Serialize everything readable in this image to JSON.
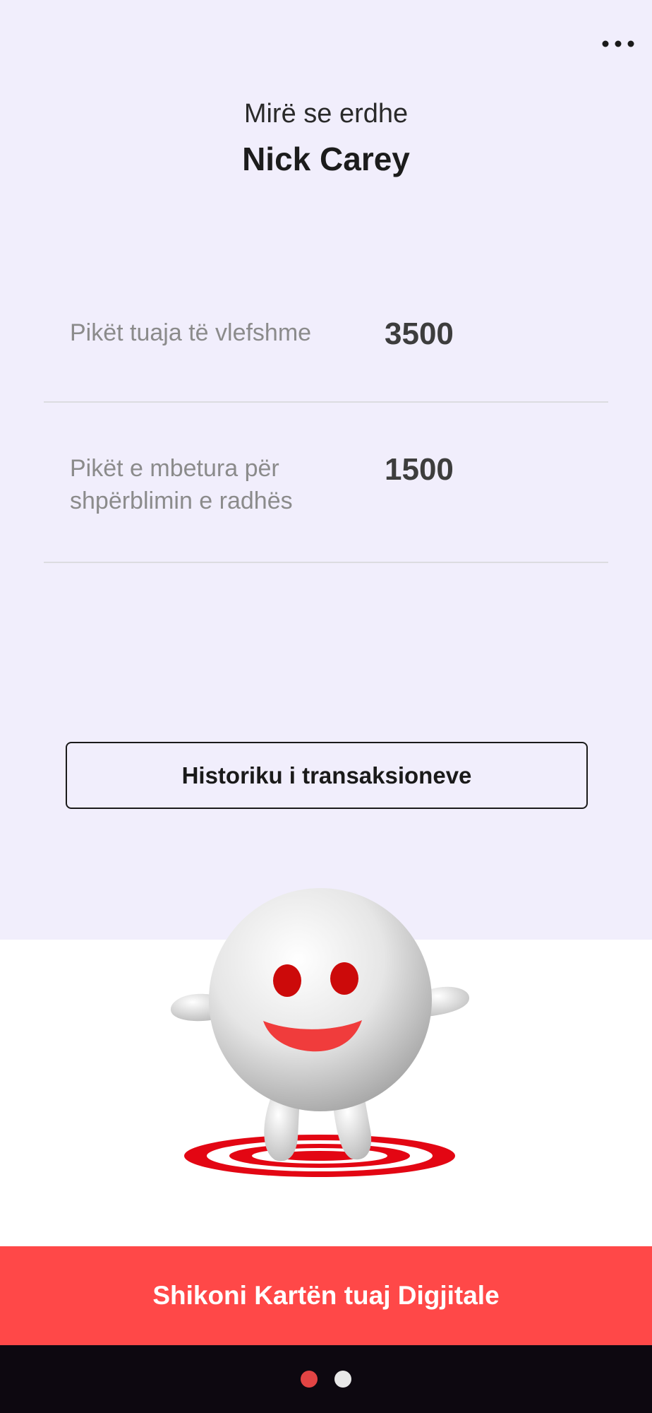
{
  "header": {
    "welcome_text": "Mirë se erdhe",
    "user_name": "Nick Carey",
    "menu_icon": "more-horizontal-icon"
  },
  "points": {
    "available": {
      "label": "Pikët tuaja të vlefshme",
      "value": "3500"
    },
    "remaining": {
      "label": "Pikët e mbetura për shpërblimin e radhës",
      "value": "1500"
    }
  },
  "history_button": {
    "label": "Historiku i transaksioneve"
  },
  "mascot": {
    "icon": "smiling-mascot-on-target"
  },
  "cta": {
    "label": "Shikoni Kartën tuaj Digjitale"
  },
  "pager": {
    "count": 2,
    "active_index": 0
  },
  "colors": {
    "background_top": "#f1eefc",
    "accent": "#ff4848",
    "bottom_bar": "#0d0810",
    "active_dot": "#e24444",
    "inactive_dot": "#e8e8e8"
  }
}
